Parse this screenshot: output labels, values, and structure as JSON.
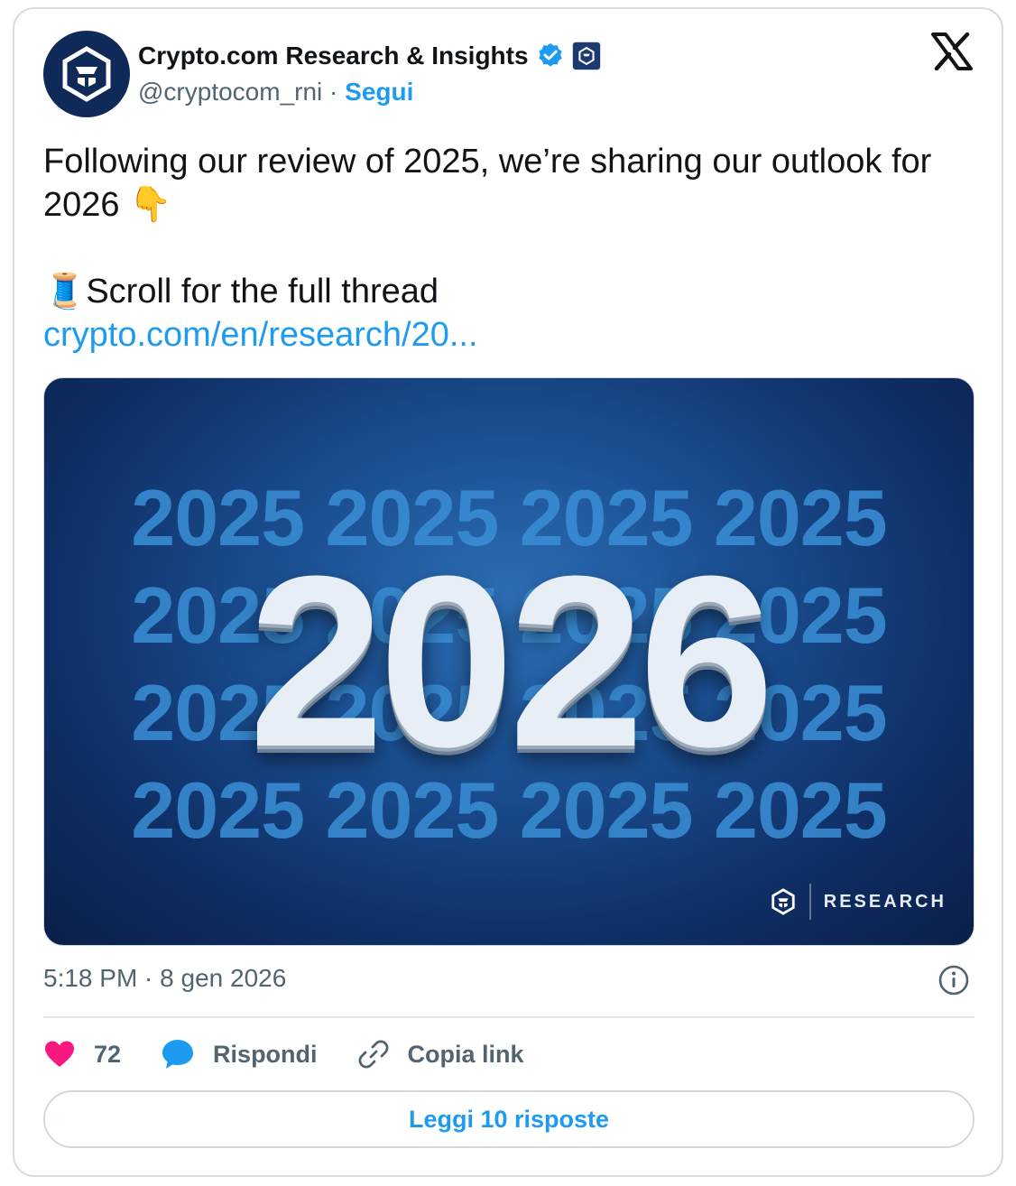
{
  "author": {
    "name": "Crypto.com Research & Insights",
    "handle": "@cryptocom_rni",
    "separator": "·",
    "follow_label": "Segui"
  },
  "tweet": {
    "line1": "Following our review of 2025, we’re sharing our outlook for",
    "line2": "2026 👇",
    "line3": "🧵Scroll for the full thread",
    "link": "crypto.com/en/research/20..."
  },
  "media": {
    "bg_rows": [
      "2025 2025 2025 2025",
      "2025 2025 2025 2025",
      "2025 2025 2025 2025",
      "2025 2025 2025 2025"
    ],
    "headline": "2026",
    "brand_label": "RESEARCH"
  },
  "meta": {
    "timestamp": "5:18 PM · 8 gen 2026"
  },
  "actions": {
    "likes": "72",
    "reply_label": "Rispondi",
    "copy_label": "Copia link"
  },
  "read_replies_label": "Leggi 10 risposte",
  "colors": {
    "accent": "#1d9bf0",
    "like": "#f91880",
    "avatar_bg": "#0f2a59"
  }
}
